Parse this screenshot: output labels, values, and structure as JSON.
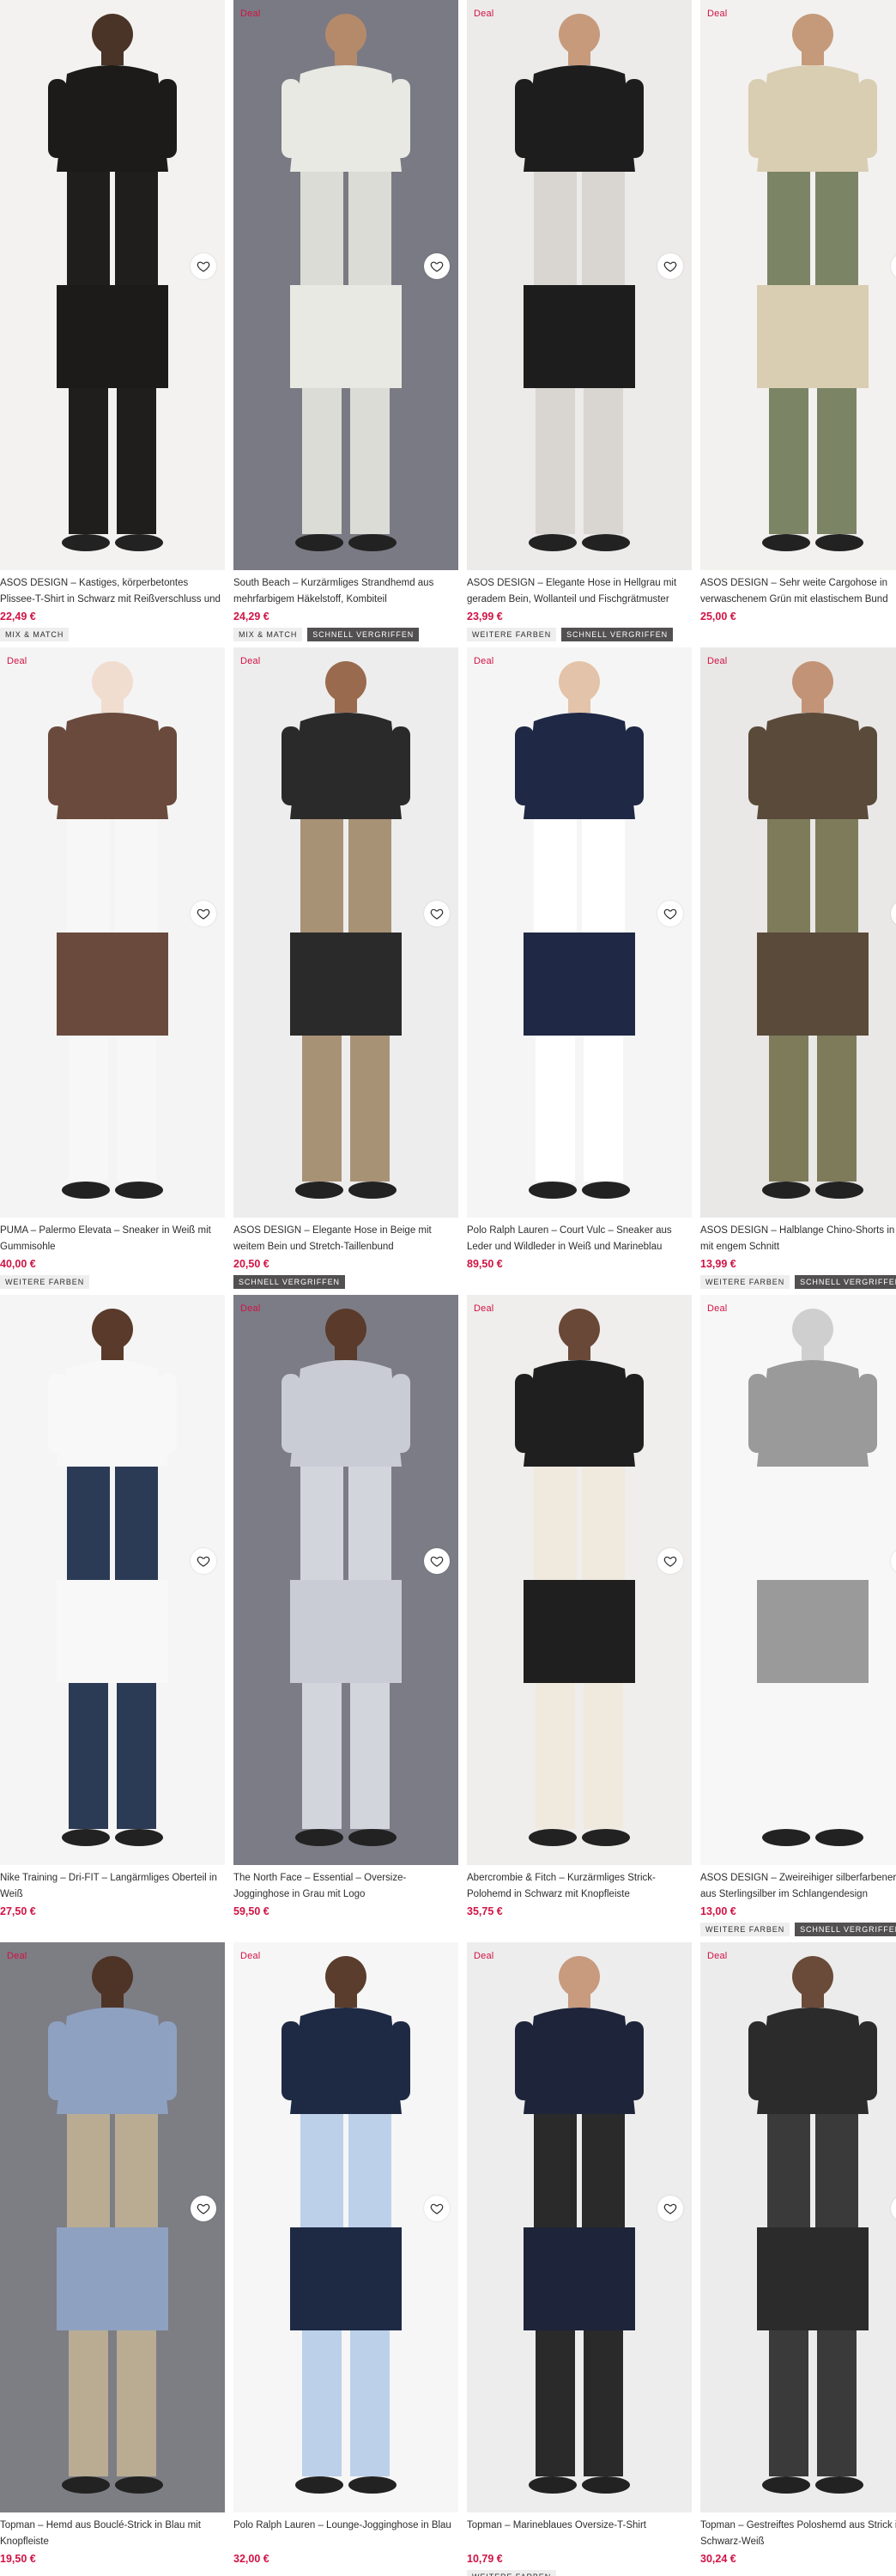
{
  "products": [
    {
      "deal": "",
      "title": "ASOS DESIGN – Kastiges, körperbetontes Plissee-T-Shirt in Schwarz mit Reißverschluss und Stehkrage…",
      "price": "22,49 €",
      "tags": [
        "MIX & MATCH"
      ],
      "palette": {
        "bg": "#f3f2f0",
        "fig": "#1c1b1a",
        "skin": "#4a3428",
        "low": "#1f1e1c"
      }
    },
    {
      "deal": "Deal",
      "title": "South Beach – Kurzärmliges Strandhemd aus mehrfarbigem Häkelstoff, Kombiteil",
      "price": "24,29 €",
      "tags": [
        "MIX & MATCH",
        "SCHNELL VERGRIFFEN"
      ],
      "palette": {
        "bg": "#7a7a84",
        "fig": "#e9e9e4",
        "skin": "#b58a6b",
        "low": "#dcdcd6"
      }
    },
    {
      "deal": "Deal",
      "title": "ASOS DESIGN – Elegante Hose in Hellgrau mit geradem Bein, Wollanteil und Fischgrätmuster",
      "price": "23,99 €",
      "tags": [
        "WEITERE FARBEN",
        "SCHNELL VERGRIFFEN"
      ],
      "palette": {
        "bg": "#ecebea",
        "fig": "#1d1d1d",
        "skin": "#c79a7c",
        "low": "#d9d6d1"
      }
    },
    {
      "deal": "Deal",
      "title": "ASOS DESIGN – Sehr weite Cargohose in verwaschenem Grün mit elastischem Bund",
      "price": "25,00 €",
      "tags": [],
      "palette": {
        "bg": "#f2f1ef",
        "fig": "#d9cdb2",
        "skin": "#c59a7a",
        "low": "#7c8466"
      }
    },
    {
      "deal": "Deal",
      "title": "PUMA – Palermo Elevata – Sneaker in Weiß mit Gummisohle",
      "price": "40,00 €",
      "tags": [
        "WEITERE FARBEN"
      ],
      "palette": {
        "bg": "#f4f4f4",
        "fig": "#6a4a3c",
        "skin": "#f0ddd0",
        "low": "#f7f7f7"
      }
    },
    {
      "deal": "Deal",
      "title": "ASOS DESIGN – Elegante Hose in Beige mit weitem Bein und Stretch-Taillenbund",
      "price": "20,50 €",
      "tags": [
        "SCHNELL VERGRIFFEN"
      ],
      "palette": {
        "bg": "#ededed",
        "fig": "#2a2a2a",
        "skin": "#9a6a4e",
        "low": "#a89276"
      }
    },
    {
      "deal": "Deal",
      "title": "Polo Ralph Lauren – Court Vulc – Sneaker aus Leder und Wildleder in Weiß und Marineblau",
      "price": "89,50 €",
      "tags": [],
      "palette": {
        "bg": "#f5f5f5",
        "fig": "#1f2844",
        "skin": "#e3c3a9",
        "low": "#ffffff"
      }
    },
    {
      "deal": "Deal",
      "title": "ASOS DESIGN – Halblange Chino-Shorts in Khaki mit engem Schnitt",
      "price": "13,99 €",
      "tags": [
        "WEITERE FARBEN",
        "SCHNELL VERGRIFFEN"
      ],
      "palette": {
        "bg": "#e9e8e6",
        "fig": "#5a4a3a",
        "skin": "#c39377",
        "low": "#7d7b5a"
      }
    },
    {
      "deal": "",
      "title": "Nike Training – Dri-FIT – Langärmliges Oberteil in Weiß",
      "price": "27,50 €",
      "tags": [],
      "palette": {
        "bg": "#f5f5f5",
        "fig": "#f8f8f8",
        "skin": "#5a3a2a",
        "low": "#2b3a55"
      }
    },
    {
      "deal": "Deal",
      "title": "The North Face – Essential – Oversize-Jogginghose in Grau mit Logo",
      "price": "59,50 €",
      "tags": [],
      "palette": {
        "bg": "#7c7c86",
        "fig": "#c9ccd4",
        "skin": "#5a3a2a",
        "low": "#d2d5dc"
      }
    },
    {
      "deal": "Deal",
      "title": "Abercrombie & Fitch – Kurzärmliges Strick-Polohemd in Schwarz mit Knopfleiste",
      "price": "35,75 €",
      "tags": [],
      "palette": {
        "bg": "#efeeec",
        "fig": "#1f1f1f",
        "skin": "#6a4838",
        "low": "#efe9de"
      }
    },
    {
      "deal": "Deal",
      "title": "ASOS DESIGN – Zweireihiger silberfarbener Ring aus Sterlingsilber im Schlangendesign",
      "price": "13,00 €",
      "tags": [
        "WEITERE FARBEN",
        "SCHNELL VERGRIFFEN"
      ],
      "palette": {
        "bg": "#f7f7f7",
        "fig": "#9a9a9a",
        "skin": "#cfcfcf",
        "low": "#f7f7f7"
      }
    },
    {
      "deal": "Deal",
      "title": "Topman – Hemd aus Bouclé-Strick in Blau mit Knopfleiste",
      "price": "19,50 €",
      "tags": [],
      "palette": {
        "bg": "#7d7d84",
        "fig": "#8fa1c1",
        "skin": "#4e3426",
        "low": "#b9ac93"
      }
    },
    {
      "deal": "Deal",
      "title": "Polo Ralph Lauren – Lounge-Jogginghose in Blau",
      "price": "32,00 €",
      "tags": [],
      "palette": {
        "bg": "#f6f6f6",
        "fig": "#1e2a44",
        "skin": "#5b3d2d",
        "low": "#bcd0ea"
      }
    },
    {
      "deal": "Deal",
      "title": "Topman – Marineblaues Oversize-T-Shirt",
      "price": "10,79 €",
      "tags": [
        "WEITERE FARBEN"
      ],
      "palette": {
        "bg": "#ededed",
        "fig": "#1e2439",
        "skin": "#c89a7e",
        "low": "#2a2a2a"
      }
    },
    {
      "deal": "Deal",
      "title": "Topman – Gestreiftes Poloshemd aus Strick in Schwarz-Weiß",
      "price": "30,24 €",
      "tags": [],
      "palette": {
        "bg": "#ececec",
        "fig": "#2b2b2b",
        "skin": "#6a4a38",
        "low": "#3a3a3a"
      }
    }
  ],
  "icons": {
    "wishlist": "heart-outline-icon"
  },
  "colors": {
    "price": "#d01345",
    "deal": "#d01345",
    "tag_dark": "#525050",
    "tag_light": "#eeeeee"
  }
}
